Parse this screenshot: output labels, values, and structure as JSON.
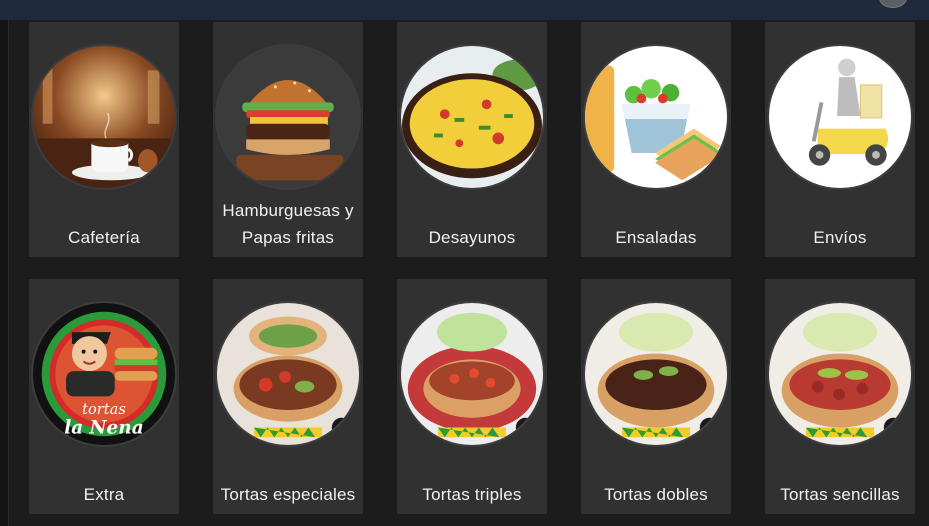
{
  "categories": [
    {
      "label": "Cafetería",
      "icon": "coffee-cup-icon"
    },
    {
      "label": "Hamburguesas y Papas fritas",
      "icon": "burger-icon"
    },
    {
      "label": "Desayunos",
      "icon": "scrambled-eggs-icon"
    },
    {
      "label": "Ensaladas",
      "icon": "salad-sandwich-icon"
    },
    {
      "label": "Envíos",
      "icon": "delivery-scooter-icon"
    },
    {
      "label": "Extra",
      "icon": "tortas-la-nena-logo",
      "logo_text": [
        "tortas",
        "la Nena"
      ]
    },
    {
      "label": "Tortas especiales",
      "icon": "torta-especial-icon"
    },
    {
      "label": "Tortas triples",
      "icon": "torta-triple-icon"
    },
    {
      "label": "Tortas dobles",
      "icon": "torta-doble-icon"
    },
    {
      "label": "Tortas sencillas",
      "icon": "torta-sencilla-icon"
    }
  ],
  "colors": {
    "card": "#313132",
    "background": "#1c1c1d",
    "topbar": "#1f2a3c",
    "text": "#f1f1f1"
  }
}
